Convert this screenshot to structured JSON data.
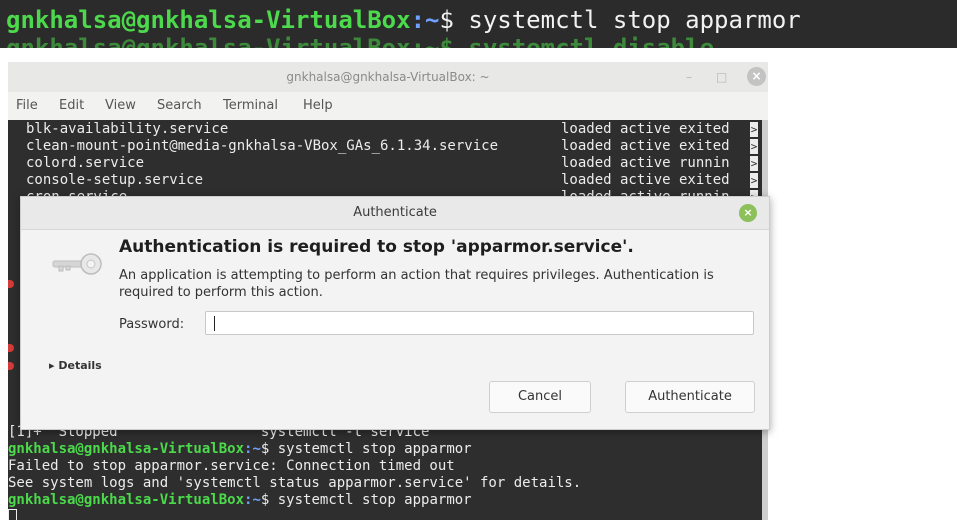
{
  "top_strip": {
    "user": "gnkhalsa@gnkhalsa-VirtualBox",
    "path": ":~",
    "prompt": "$",
    "command": " systemctl stop apparmor",
    "partial_next": "gnkhalsa@gnkhalsa-VirtualBox:~$ systemctl disable"
  },
  "terminal": {
    "title": "gnkhalsa@gnkhalsa-VirtualBox: ~",
    "controls": {
      "minimize": "–",
      "maximize": "□",
      "close": "×"
    },
    "menu": [
      "File",
      "Edit",
      "View",
      "Search",
      "Terminal",
      "Help"
    ],
    "services": [
      {
        "name": "blk-availability.service",
        "status": "loaded active exited"
      },
      {
        "name": "clean-mount-point@media-gnkhalsa-VBox_GAs_6.1.34.service",
        "status": "loaded active exited"
      },
      {
        "name": "colord.service",
        "status": "loaded active runnin"
      },
      {
        "name": "console-setup.service",
        "status": "loaded active exited"
      },
      {
        "name": "cron.service",
        "status": "loaded active runnin"
      }
    ],
    "overflow_mark": ">",
    "output": [
      "[1]+  Stopped                 systemctl -t service",
      {
        "user": "gnkhalsa@gnkhalsa-VirtualBox",
        "path": ":~",
        "prompt": "$",
        "command": " systemctl stop apparmor"
      },
      "Failed to stop apparmor.service: Connection timed out",
      "See system logs and 'systemctl status apparmor.service' for details.",
      {
        "user": "gnkhalsa@gnkhalsa-VirtualBox",
        "path": ":~",
        "prompt": "$",
        "command": " systemctl stop apparmor"
      }
    ]
  },
  "auth_dialog": {
    "title": "Authenticate",
    "close": "×",
    "heading": "Authentication is required to stop 'apparmor.service'.",
    "description": "An application is attempting to perform an action that requires privileges. Authentication is required to perform this action.",
    "password_label": "Password:",
    "password_value": "",
    "details_label": "▸ Details",
    "cancel_label": "Cancel",
    "authenticate_label": "Authenticate"
  }
}
